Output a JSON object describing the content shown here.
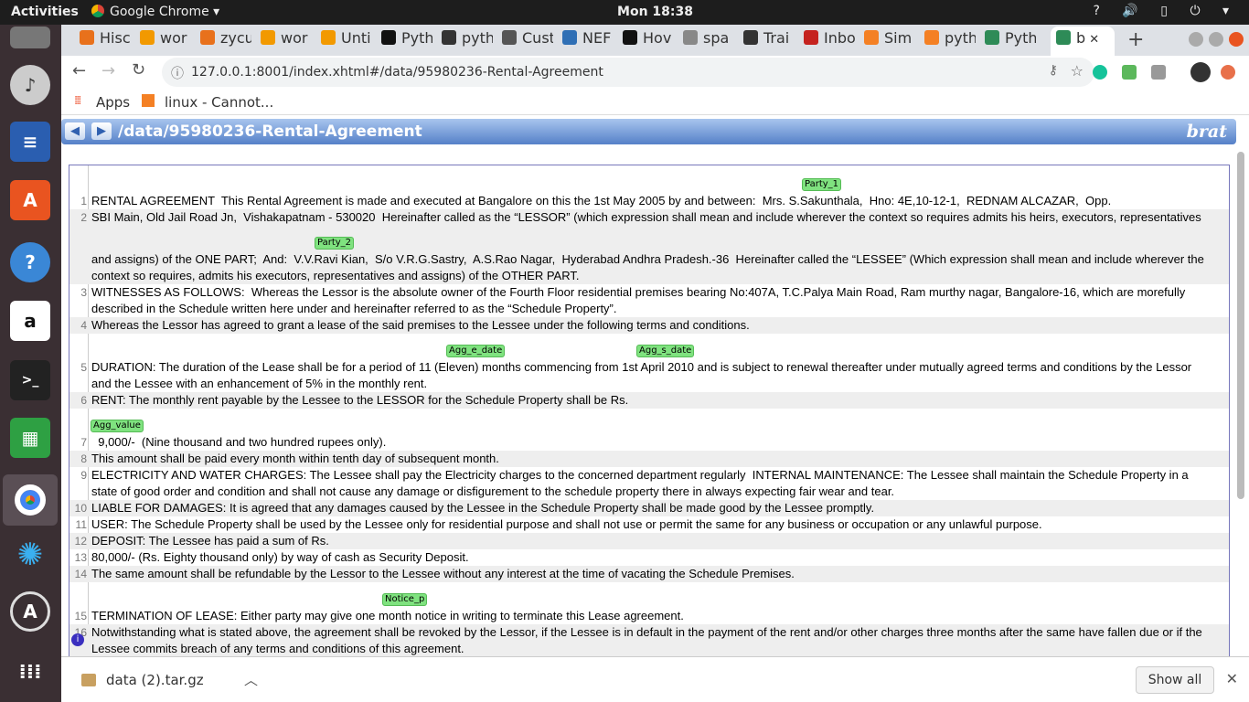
{
  "topbar": {
    "activities": "Activities",
    "app": "Google Chrome ▾",
    "clock": "Mon 18:38",
    "tray": "? 🔊 ▯ ⏻ ▾"
  },
  "tabs": [
    {
      "label": "Hisc",
      "color": "#e8711c"
    },
    {
      "label": "wor",
      "color": "#f29900"
    },
    {
      "label": "zycu",
      "color": "#e8711c"
    },
    {
      "label": "wor",
      "color": "#f29900"
    },
    {
      "label": "Unti",
      "color": "#f29900"
    },
    {
      "label": "Pyth",
      "color": "#111"
    },
    {
      "label": "pyth",
      "color": "#333"
    },
    {
      "label": "Cust",
      "color": "#555"
    },
    {
      "label": "NEF",
      "color": "#2f6fb5"
    },
    {
      "label": "Hov",
      "color": "#111"
    },
    {
      "label": "spa",
      "color": "#888"
    },
    {
      "label": "Trai",
      "color": "#333"
    },
    {
      "label": "Inbo",
      "color": "#c5221f"
    },
    {
      "label": "Sim",
      "color": "#f48024"
    },
    {
      "label": "pyth",
      "color": "#f48024"
    },
    {
      "label": "Pyth",
      "color": "#2e8b57"
    },
    {
      "label": "b",
      "color": "#2e8b57"
    }
  ],
  "toolbar": {
    "url": "127.0.0.1:8001/index.xhtml#/data/95980236-Rental-Agreement"
  },
  "bookmarks": {
    "apps": "Apps",
    "item1": "linux - Cannot..."
  },
  "brat": {
    "path": "/data/95980236-Rental-Agreement",
    "logo": "brat"
  },
  "doc": {
    "lines": [
      {
        "n": "1",
        "text": "RENTAL AGREEMENT  This Rental Agreement is made and executed at Bangalore on this the 1st May 2005 by and between:  Mrs. S.Sakunthala,  Hno: 4E,10-12-1,  REDNAM ALCAZAR,  Opp."
      },
      {
        "n": "2",
        "text": "SBI Main, Old Jail Road Jn,  Vishakapatnam - 530020  Hereinafter called as the “LESSOR” (which expression shall mean and include wherever the context so requires admits his heirs, executors, representatives"
      },
      {
        "n": "",
        "text": "and assigns) of the ONE PART;  And:  V.V.Ravi Kian,  S/o V.R.G.Sastry,  A.S.Rao Nagar,  Hyderabad Andhra Pradesh.-36  Hereinafter called the “LESSEE” (Which expression shall mean and include wherever the"
      },
      {
        "n": "",
        "text": "context so requires, admits his executors, representatives and assigns) of the OTHER PART."
      },
      {
        "n": "3",
        "text": "WITNESSES AS FOLLOWS:  Whereas the Lessor is the absolute owner of the Fourth Floor residential premises bearing No:407A, T.C.Palya Main Road, Ram murthy nagar, Bangalore-16, which are morefully"
      },
      {
        "n": "",
        "text": "described in the Schedule written here under and hereinafter referred to as the “Schedule Property”."
      },
      {
        "n": "4",
        "text": "Whereas the Lessor has agreed to grant a lease of the said premises to the Lessee under the following terms and conditions."
      },
      {
        "n": "5",
        "text": "DURATION: The duration of the Lease shall be for a period of 11 (Eleven) months commencing from 1st April 2010 and is subject to renewal thereafter under mutually agreed terms and conditions by the Lessor"
      },
      {
        "n": "",
        "text": "and the Lessee with an enhancement of 5% in the monthly rent."
      },
      {
        "n": "6",
        "text": "RENT: The monthly rent payable by the Lessee to the LESSOR for the Schedule Property shall be Rs."
      },
      {
        "n": "7",
        "text": "  9,000/-  (Nine thousand and two hundred rupees only)."
      },
      {
        "n": "8",
        "text": "This amount shall be paid every month within tenth day of subsequent month."
      },
      {
        "n": "9",
        "text": "ELECTRICITY AND WATER CHARGES: The Lessee shall pay the Electricity charges to the concerned department regularly  INTERNAL MAINTENANCE: The Lessee shall maintain the Schedule Property in a"
      },
      {
        "n": "",
        "text": "state of good order and condition and shall not cause any damage or disfigurement to the schedule property there in always expecting fair wear and tear."
      },
      {
        "n": "10",
        "text": "LIABLE FOR DAMAGES: It is agreed that any damages caused by the Lessee in the Schedule Property shall be made good by the Lessee promptly."
      },
      {
        "n": "11",
        "text": "USER: The Schedule Property shall be used by the Lessee only for residential purpose and shall not use or permit the same for any business or occupation or any unlawful purpose."
      },
      {
        "n": "12",
        "text": "DEPOSIT: The Lessee has paid a sum of Rs."
      },
      {
        "n": "13",
        "text": "80,000/- (Rs. Eighty thousand only) by way of cash as Security Deposit."
      },
      {
        "n": "14",
        "text": "The same amount shall be refundable by the Lessor to the Lessee without any interest at the time of vacating the Schedule Premises."
      },
      {
        "n": "15",
        "text": "TERMINATION OF LEASE: Either party may give one month notice in writing to terminate this Lease agreement."
      },
      {
        "n": "16",
        "text": "Notwithstanding what is stated above, the agreement shall be revoked by the Lessor, if the Lessee is in default in the payment of the rent and/or other charges three months after the same have fallen due or if the"
      },
      {
        "n": "",
        "text": "Lessee commits breach of any terms and conditions of this agreement."
      }
    ],
    "tags": [
      {
        "label": "Party_1"
      },
      {
        "label": "Party_2"
      },
      {
        "label": "Agg_e_date"
      },
      {
        "label": "Agg_s_date"
      },
      {
        "label": "Agg_value"
      },
      {
        "label": "Notice_p"
      }
    ]
  },
  "downloads": {
    "file": "data (2).tar.gz",
    "show_all": "Show all"
  }
}
